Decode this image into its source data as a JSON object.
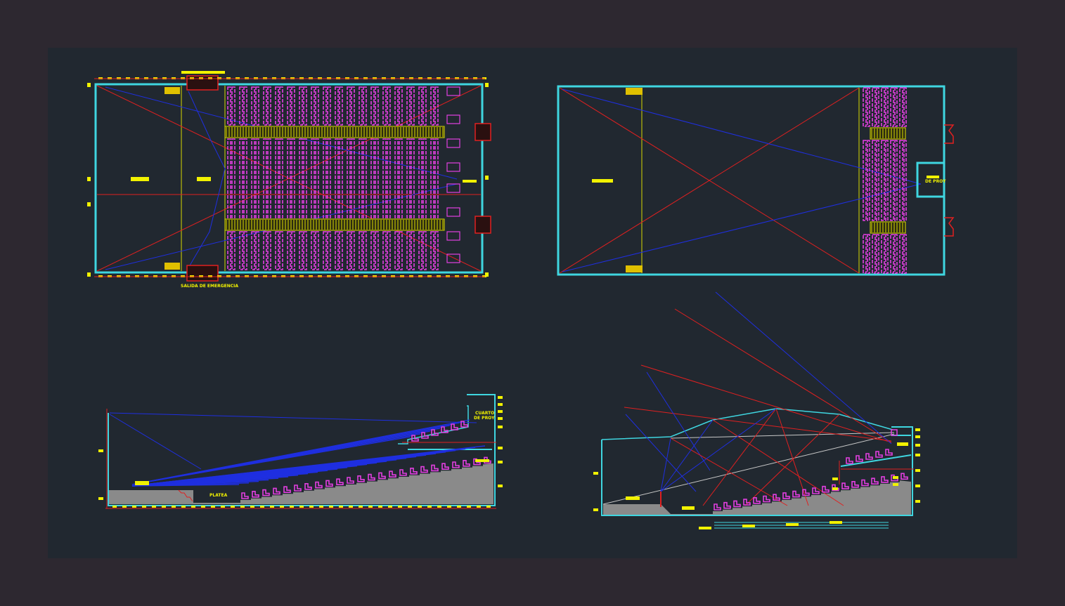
{
  "colors": {
    "background": "#2d2830",
    "canvas": "#212830",
    "wall": "#3fd6e0",
    "seat": "#e23fe0",
    "dimension": "#f2f200",
    "axis": "#e02020",
    "sightline": "#1f2fe0",
    "floor": "#8a8a8a",
    "guide": "#c8c8c8"
  },
  "plan_a": {
    "exit_label": "SALIDA DE EMERGENCIA"
  },
  "plan_b": {
    "booth_label": "DE PROY"
  },
  "section_a": {
    "booth_label_1": "CUARTO",
    "booth_label_2": "DE PROY",
    "floor_label": "PLATEA"
  }
}
